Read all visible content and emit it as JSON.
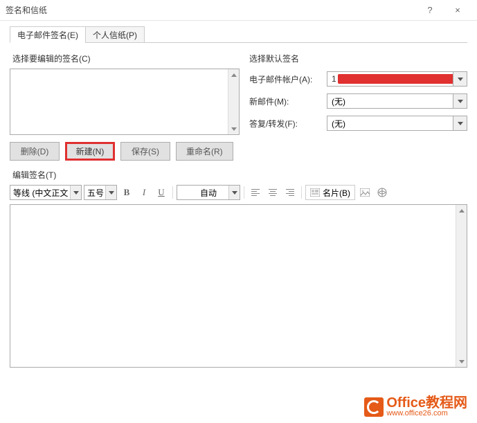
{
  "window": {
    "title": "签名和信纸",
    "help": "?",
    "close": "×"
  },
  "tabs": {
    "email": "电子邮件签名(E)",
    "stationery": "个人信纸(P)"
  },
  "select_sig_legend": "选择要编辑的签名(C)",
  "buttons": {
    "delete": "删除(D)",
    "new": "新建(N)",
    "save": "保存(S)",
    "rename": "重命名(R)"
  },
  "defaults": {
    "legend": "选择默认签名",
    "account_label": "电子邮件帐户(A):",
    "account_value_prefix": "1",
    "new_msg_label": "新邮件(M):",
    "new_msg_value": "(无)",
    "reply_label": "答复/转发(F):",
    "reply_value": "(无)"
  },
  "editor": {
    "legend": "编辑签名(T)",
    "font": "等线 (中文正文",
    "size": "五号",
    "auto": "自动",
    "card": "名片(B)"
  },
  "watermark": {
    "line1": "Office教程网",
    "line2": "www.office26.com"
  }
}
